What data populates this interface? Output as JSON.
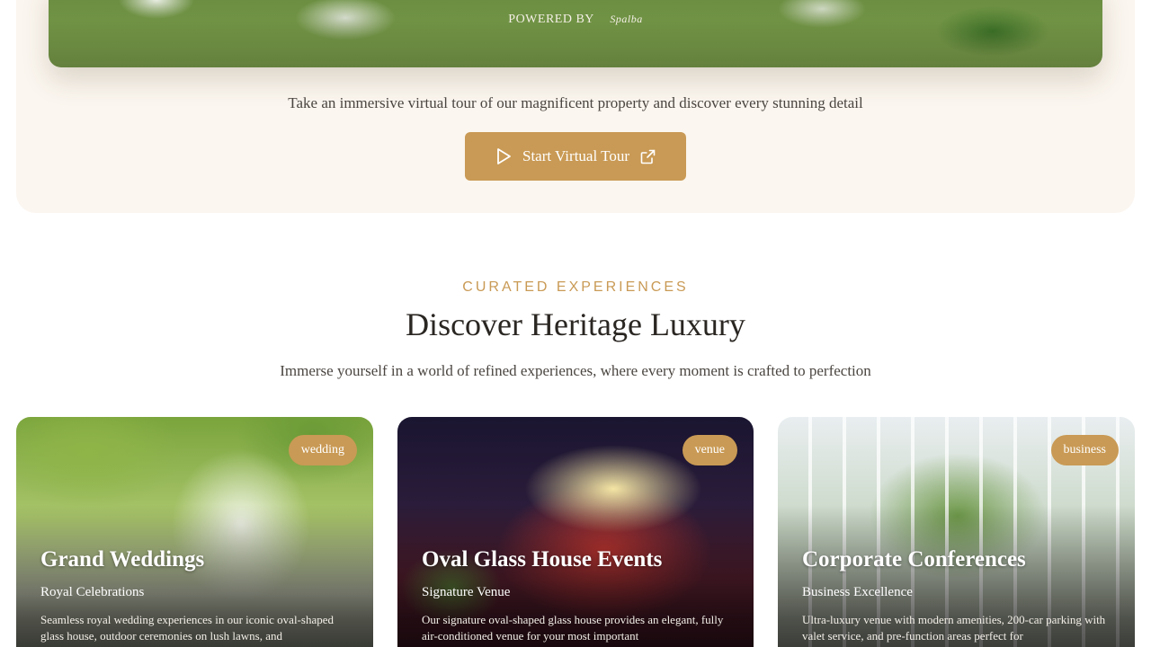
{
  "tour": {
    "powered_by": "POWERED BY",
    "powered_brand": "Spalba",
    "description": "Take an immersive virtual tour of our magnificent property and discover every stunning detail",
    "button_label": "Start Virtual Tour"
  },
  "section": {
    "eyebrow": "CURATED EXPERIENCES",
    "title": "Discover Heritage Luxury",
    "subtitle": "Immerse yourself in a world of refined experiences, where every moment is crafted to perfection"
  },
  "cards": [
    {
      "badge": "wedding",
      "title": "Grand Weddings",
      "subtitle": "Royal Celebrations",
      "description": "Seamless royal wedding experiences in our iconic oval-shaped glass house, outdoor ceremonies on lush lawns, and"
    },
    {
      "badge": "venue",
      "title": "Oval Glass House Events",
      "subtitle": "Signature Venue",
      "description": "Our signature oval-shaped glass house provides an elegant, fully air-conditioned venue for your most important"
    },
    {
      "badge": "business",
      "title": "Corporate Conferences",
      "subtitle": "Business Excellence",
      "description": "Ultra-luxury venue with modern amenities, 200-car parking with valet service, and pre-function areas perfect for"
    }
  ],
  "colors": {
    "accent": "#c99a55",
    "panel": "#fbf6ef",
    "text": "#2a2622"
  },
  "icons": {
    "button_leading": "play-icon",
    "button_trailing": "external-link-icon"
  }
}
